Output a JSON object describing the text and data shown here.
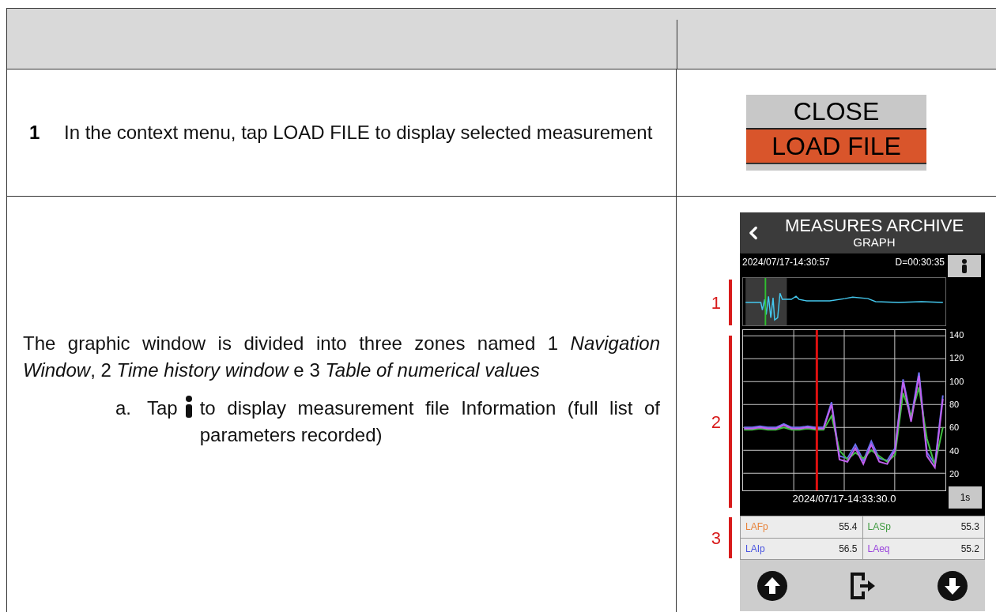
{
  "steps": [
    {
      "number": "1",
      "text": "In the context menu, tap LOAD FILE to display selected measurement",
      "figure": {
        "kind": "menu",
        "items": [
          {
            "label": "CLOSE",
            "selected": false
          },
          {
            "label": "LOAD FILE",
            "selected": true
          }
        ]
      }
    },
    {
      "paragraph": "The graphic window is divided into three zones named 1 *Navigation Window*, 2 *Time history window* e 3 *Table of numerical values*",
      "substeps": [
        {
          "marker": "a.",
          "before": "Tap",
          "after": "to display measurement file Information (full list of parameters recorded)"
        }
      ],
      "figure": {
        "kind": "device",
        "title": "MEASURES ARCHIVE",
        "subtitle": "GRAPH",
        "start_time": "2024/07/17-14:30:57",
        "duration": "D=00:30:35",
        "zones": [
          "1",
          "2",
          "3"
        ],
        "chart_data": {
          "type": "line",
          "grid": true,
          "ylim": [
            5,
            145
          ],
          "yticks": [
            140,
            120,
            100,
            80,
            60,
            40,
            20
          ],
          "series": [
            {
              "color": "#6a70f0",
              "values": [
                60,
                60,
                61,
                60,
                60,
                63,
                60,
                60,
                61,
                60,
                60,
                82,
                35,
                33,
                45,
                31,
                48,
                33,
                31,
                42,
                102,
                68,
                108,
                38,
                28,
                88
              ]
            },
            {
              "color": "#40c040",
              "values": [
                58,
                58,
                59,
                58,
                58,
                60,
                58,
                58,
                59,
                58,
                58,
                70,
                40,
                32,
                38,
                33,
                40,
                35,
                30,
                36,
                90,
                70,
                95,
                50,
                27,
                60
              ]
            },
            {
              "color": "#c060ee",
              "values": [
                59,
                59,
                60,
                59,
                59,
                62,
                59,
                59,
                60,
                59,
                59,
                80,
                32,
                30,
                42,
                28,
                45,
                30,
                28,
                40,
                100,
                65,
                105,
                35,
                25,
                85
              ]
            }
          ]
        },
        "cursor_time": "2024/07/17-14:33:30.0",
        "resolution": "1s",
        "readings": [
          {
            "name": "LAFp",
            "value": "55.4",
            "color": "#e8833a"
          },
          {
            "name": "LASp",
            "value": "55.3",
            "color": "#3f9a3f"
          },
          {
            "name": "LAIp",
            "value": "56.5",
            "color": "#4a55e0"
          },
          {
            "name": "LAeq",
            "value": "55.2",
            "color": "#9a44dd"
          }
        ]
      }
    }
  ]
}
